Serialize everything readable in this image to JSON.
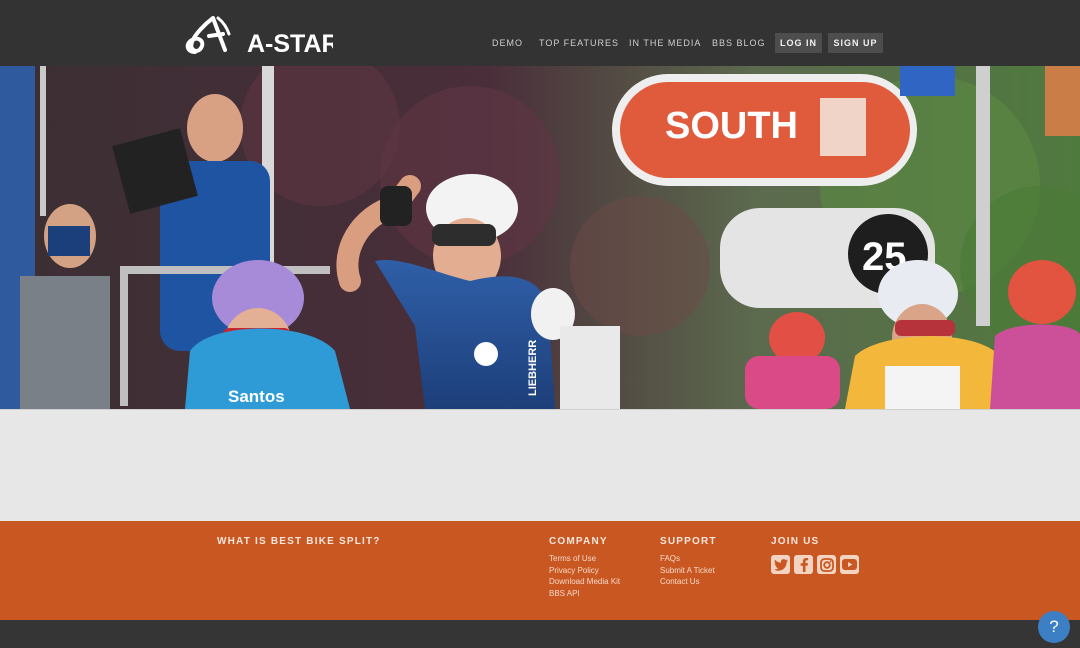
{
  "header": {
    "logo_text": "A-STAR",
    "nav": {
      "demo": "DEMO",
      "top_features": "TOP FEATURES",
      "in_the_media": "IN THE MEDIA",
      "bbs_blog": "BBS BLOG"
    },
    "login_label": "LOG IN",
    "signup_label": "SIGN UP"
  },
  "hero": {
    "sign_text": "SOUTH",
    "number_sign": "25",
    "jersey_left": "Santos",
    "jersey_center": "LIEBHERR"
  },
  "footer": {
    "about_heading": "WHAT IS BEST BIKE SPLIT?",
    "company": {
      "heading": "COMPANY",
      "links": [
        "Terms of Use",
        "Privacy Policy",
        "Download Media Kit",
        "BBS API"
      ]
    },
    "support": {
      "heading": "SUPPORT",
      "links": [
        "FAQs",
        "Submit A Ticket",
        "Contact Us"
      ]
    },
    "join": {
      "heading": "JOIN US",
      "icons": [
        "twitter-icon",
        "facebook-icon",
        "instagram-icon",
        "youtube-icon"
      ]
    }
  },
  "help_label": "?",
  "colors": {
    "topbar": "#333333",
    "footer": "#c95722",
    "help_button": "#3d7fc4"
  }
}
